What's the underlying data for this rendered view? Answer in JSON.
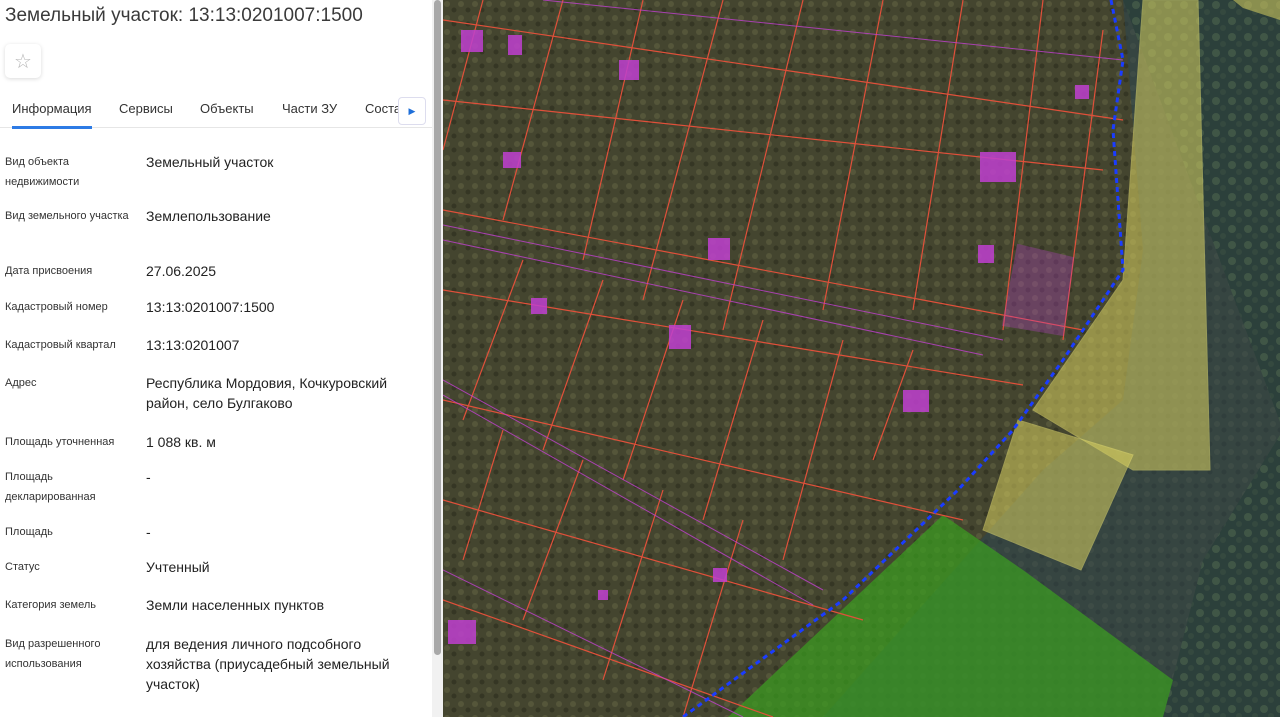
{
  "title": "Земельный участок: 13:13:0201007:1500",
  "favorite_icon": "star-icon",
  "tabs": [
    {
      "label": "Информация"
    },
    {
      "label": "Сервисы"
    },
    {
      "label": "Объекты"
    },
    {
      "label": "Части ЗУ"
    },
    {
      "label": "Соста"
    }
  ],
  "fields": [
    {
      "label": "Вид объекта недвижимости",
      "value": "Земельный участок"
    },
    {
      "label": "Вид земельного участка",
      "value": "Землепользование"
    },
    {
      "label": "Дата присвоения",
      "value": "27.06.2025"
    },
    {
      "label": "Кадастровый номер",
      "value": "13:13:0201007:1500"
    },
    {
      "label": "Кадастровый квартал",
      "value": "13:13:0201007"
    },
    {
      "label": "Адрес",
      "value": "Республика Мордовия, Кочкуровский район, село Булгаково"
    },
    {
      "label": "Площадь уточненная",
      "value": "1 088 кв. м"
    },
    {
      "label": "Площадь декларированная",
      "value": "-"
    },
    {
      "label": "Площадь",
      "value": "-"
    },
    {
      "label": "Статус",
      "value": "Учтенный"
    },
    {
      "label": "Категория земель",
      "value": "Земли населенных пунктов"
    },
    {
      "label": "Вид разрешенного использования",
      "value": "для ведения личного подсобного хозяйства (приусадебный земельный участок)"
    }
  ],
  "colors": {
    "accent": "#2d7be5",
    "parcel": "#e0503a",
    "building": "#c040d0",
    "zone_yellow": "#d8d060",
    "forest": "#3aa020",
    "boundary": "#1a3cff"
  }
}
